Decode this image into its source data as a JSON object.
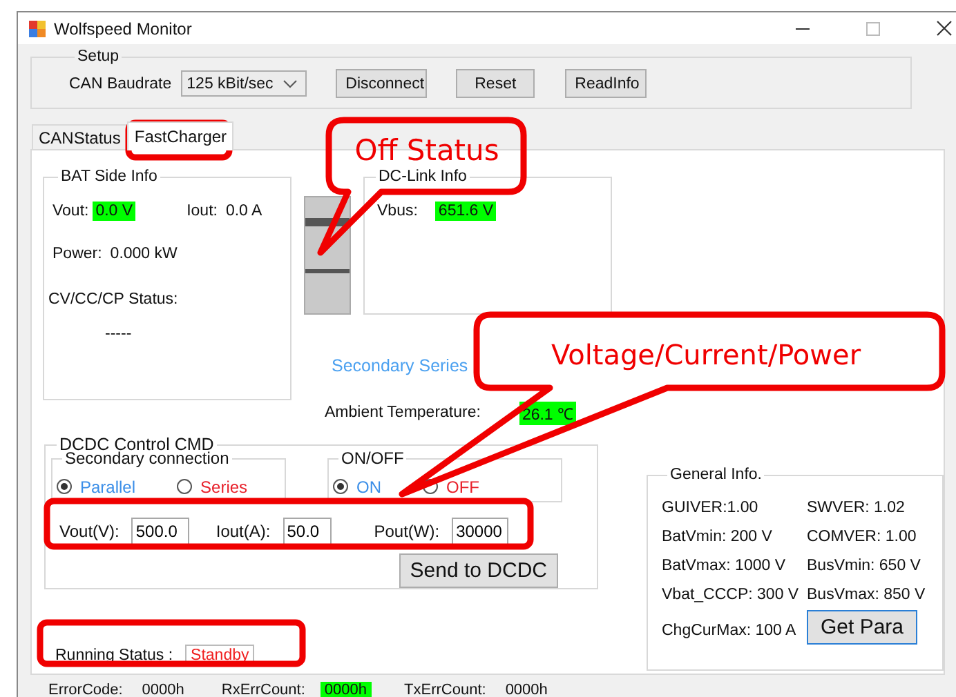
{
  "window": {
    "title": "Wolfspeed Monitor"
  },
  "setup": {
    "title": "Setup",
    "baud_label": "CAN Baudrate",
    "baud_value": "125 kBit/sec",
    "buttons": [
      "Disconnect",
      "Reset",
      "ReadInfo"
    ]
  },
  "tabs": [
    {
      "label": "CANStatus",
      "selected": false
    },
    {
      "label": "FastCharger",
      "selected": true
    }
  ],
  "bat_side": {
    "title": "BAT Side Info",
    "vout_label": "Vout:",
    "vout_value": "0.0 V",
    "iout_label": "Iout:",
    "iout_value": "0.0 A",
    "power_label": "Power:",
    "power_value": "0.000 kW",
    "mode_label": "CV/CC/CP Status:",
    "mode_value": "-----"
  },
  "dc_link": {
    "title": "DC-Link Info",
    "vbus_label": "Vbus:",
    "vbus_value": "651.6 V"
  },
  "connection_status": "Secondary Series",
  "ambient": {
    "label": "Ambient Temperature:",
    "value": "26.1 ℃"
  },
  "dcdc": {
    "title": "DCDC Control CMD",
    "groups": [
      {
        "title": "Secondary connection",
        "options": [
          {
            "label": "Parallel",
            "selected": true,
            "color": "#3b8ee8"
          },
          {
            "label": "Series",
            "selected": false,
            "color": "#e8202a"
          }
        ]
      },
      {
        "title": "ON/OFF",
        "options": [
          {
            "label": "ON",
            "selected": true,
            "color": "#3b8ee8"
          },
          {
            "label": "OFF",
            "selected": false,
            "color": "#e8202a"
          }
        ]
      }
    ],
    "fields": [
      {
        "label": "Vout(V):",
        "value": "500.0"
      },
      {
        "label": "Iout(A):",
        "value": "50.0"
      },
      {
        "label": "Pout(W):",
        "value": "30000"
      }
    ],
    "send_button": "Send to DCDC"
  },
  "running_status": {
    "label": "Running Status :",
    "value": "Standby"
  },
  "general_info": {
    "title": "General Info.",
    "items": [
      "GUIVER:1.00",
      "SWVER: 1.02",
      "BatVmin: 200 V",
      "COMVER: 1.00",
      "BatVmax: 1000 V",
      "BusVmin: 650 V",
      "Vbat_CCCP: 300 V",
      "BusVmax: 850 V",
      "ChgCurMax: 100 A"
    ],
    "button": "Get Para"
  },
  "status_bar": [
    {
      "label": "ErrorCode:",
      "value": "0000h",
      "highlighted": false
    },
    {
      "label": "RxErrCount:",
      "value": "0000h",
      "highlighted": true
    },
    {
      "label": "TxErrCount:",
      "value": "0000h",
      "highlighted": false
    }
  ],
  "annotations": [
    {
      "kind": "bubble",
      "text": "Off Status"
    },
    {
      "kind": "bubble",
      "text": "Voltage/Current/Power"
    },
    {
      "kind": "frame"
    },
    {
      "kind": "frame"
    },
    {
      "kind": "frame"
    }
  ]
}
